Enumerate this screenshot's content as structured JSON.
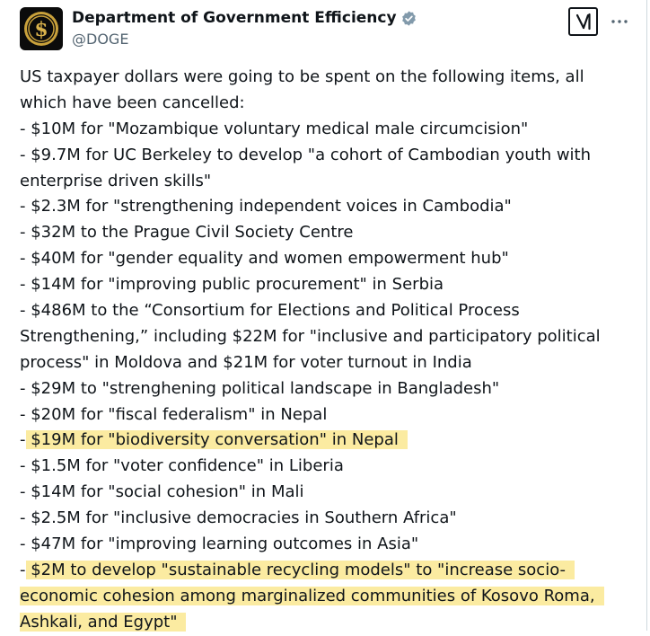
{
  "author": {
    "display_name": "Department of Government Efficiency",
    "handle": "@DOGE",
    "avatar_symbol": "$",
    "verified": true
  },
  "icons": {
    "verified": "verified-badge-icon",
    "grok": "grok-icon",
    "more": "more-icon"
  },
  "colors": {
    "highlight": "#fbeba1",
    "verified_badge": "#829aab",
    "text": "#0f1419",
    "secondary_text": "#536471"
  },
  "tweet": {
    "lines": [
      {
        "lead": "",
        "text": "US taxpayer dollars were going to be spent on the following items, all"
      },
      {
        "lead": "",
        "text": "which have been cancelled:"
      },
      {
        "lead": "",
        "text": "- $10M for \"Mozambique voluntary medical male circumcision\""
      },
      {
        "lead": "",
        "text": "- $9.7M for UC Berkeley to develop \"a cohort of Cambodian youth with"
      },
      {
        "lead": "",
        "text": "enterprise driven skills\""
      },
      {
        "lead": "",
        "text": "- $2.3M for \"strengthening independent voices in Cambodia\""
      },
      {
        "lead": "",
        "text": "- $32M to the Prague Civil Society Centre"
      },
      {
        "lead": "",
        "text": "- $40M for \"gender equality and women empowerment hub\""
      },
      {
        "lead": "",
        "text": "- $14M for \"improving public procurement\" in Serbia"
      },
      {
        "lead": "",
        "text": "- $486M to the “Consortium for Elections and Political Process"
      },
      {
        "lead": "",
        "text": "Strengthening,” including $22M for \"inclusive and participatory political"
      },
      {
        "lead": "",
        "text": "process\" in Moldova and $21M for voter turnout in India"
      },
      {
        "lead": "",
        "text": "- $29M to \"strenghening political landscape in Bangladesh\""
      },
      {
        "lead": "",
        "text": "- $20M for \"fiscal federalism\" in Nepal"
      },
      {
        "lead": "-",
        "text": " $19M for \"biodiversity conversation\" in Nepal"
      },
      {
        "lead": "",
        "text": "- $1.5M for \"voter confidence\" in Liberia"
      },
      {
        "lead": "",
        "text": "- $14M for \"social cohesion\" in Mali"
      },
      {
        "lead": "",
        "text": "- $2.5M for \"inclusive democracies in Southern Africa\""
      },
      {
        "lead": "",
        "text": "- $47M for \"improving learning outcomes in Asia\""
      },
      {
        "lead": "-",
        "text": " $2M to develop \"sustainable recycling models\" to \"increase socio-"
      },
      {
        "lead": "",
        "text": "economic cohesion among marginalized communities of Kosovo Roma,"
      },
      {
        "lead": "",
        "text": "Ashkali, and Egypt\""
      }
    ]
  }
}
